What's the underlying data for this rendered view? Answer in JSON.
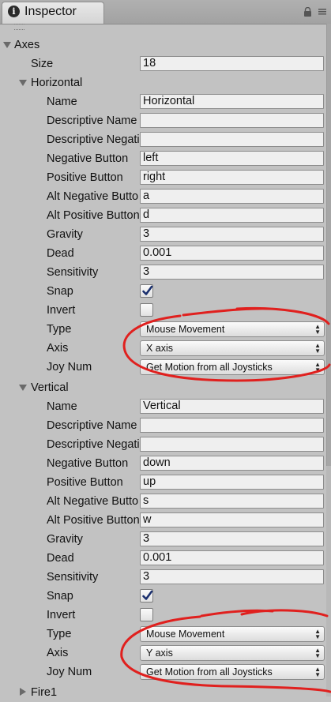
{
  "tab": {
    "title": "Inspector"
  },
  "icons": {
    "tab": "info-icon",
    "lock": "lock-icon",
    "menu": "panel-menu-icon"
  },
  "axes": {
    "label": "Axes",
    "size_label": "Size",
    "size_value": "18",
    "horizontal": {
      "label": "Horizontal",
      "name_label": "Name",
      "name_value": "Horizontal",
      "desc_name_label": "Descriptive Name",
      "desc_name_value": "",
      "desc_neg_label": "Descriptive Negative Name",
      "desc_neg_value": "",
      "neg_button_label": "Negative Button",
      "neg_button_value": "left",
      "pos_button_label": "Positive Button",
      "pos_button_value": "right",
      "alt_neg_label": "Alt Negative Button",
      "alt_neg_value": "a",
      "alt_pos_label": "Alt Positive Button",
      "alt_pos_value": "d",
      "gravity_label": "Gravity",
      "gravity_value": "3",
      "dead_label": "Dead",
      "dead_value": "0.001",
      "sensitivity_label": "Sensitivity",
      "sensitivity_value": "3",
      "snap_label": "Snap",
      "snap_checked": true,
      "invert_label": "Invert",
      "invert_checked": false,
      "type_label": "Type",
      "type_value": "Mouse Movement",
      "axis_label": "Axis",
      "axis_value": "X axis",
      "joy_label": "Joy Num",
      "joy_value": "Get Motion from all Joysticks"
    },
    "vertical": {
      "label": "Vertical",
      "name_label": "Name",
      "name_value": "Vertical",
      "desc_name_label": "Descriptive Name",
      "desc_name_value": "",
      "desc_neg_label": "Descriptive Negative Name",
      "desc_neg_value": "",
      "neg_button_label": "Negative Button",
      "neg_button_value": "down",
      "pos_button_label": "Positive Button",
      "pos_button_value": "up",
      "alt_neg_label": "Alt Negative Button",
      "alt_neg_value": "s",
      "alt_pos_label": "Alt Positive Button",
      "alt_pos_value": "w",
      "gravity_label": "Gravity",
      "gravity_value": "3",
      "dead_label": "Dead",
      "dead_value": "0.001",
      "sensitivity_label": "Sensitivity",
      "sensitivity_value": "3",
      "snap_label": "Snap",
      "snap_checked": true,
      "invert_label": "Invert",
      "invert_checked": false,
      "type_label": "Type",
      "type_value": "Mouse Movement",
      "axis_label": "Axis",
      "axis_value": "Y axis",
      "joy_label": "Joy Num",
      "joy_value": "Get Motion from all Joysticks"
    },
    "next_item_label": "Fire1"
  },
  "colors": {
    "annotation": "#e0201e",
    "panel": "#c2c2c2",
    "field": "#efefef"
  }
}
